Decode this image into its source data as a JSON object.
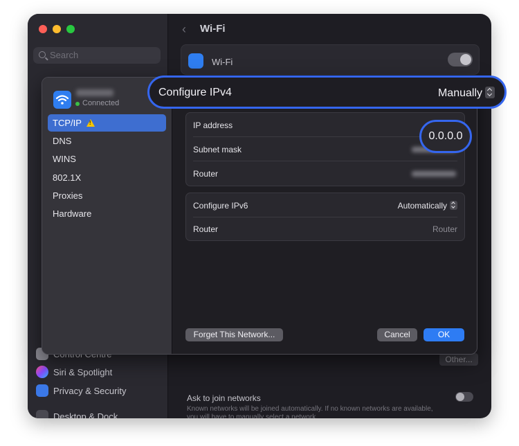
{
  "window": {
    "traffic_lights": [
      "#fe5f57",
      "#febc2e",
      "#28c840"
    ],
    "search_placeholder": "Search"
  },
  "sidebar": {
    "items": [
      {
        "label": "Control Centre",
        "icon": "control-centre-icon",
        "color": "#8e8d96"
      },
      {
        "label": "Siri & Spotlight",
        "icon": "siri-icon",
        "color": "#c24ad6"
      },
      {
        "label": "Privacy & Security",
        "icon": "hand-icon",
        "color": "#3b78e7"
      },
      {
        "label": "Desktop & Dock",
        "icon": "desktop-icon",
        "color": "#4a4951"
      }
    ]
  },
  "header": {
    "title": "Wi-Fi"
  },
  "wifi_card": {
    "label": "Wi-Fi"
  },
  "other_button": "Other...",
  "ask": {
    "title": "Ask to join networks",
    "description": "Known networks will be joined automatically. If no known networks are available, you will have to manually select a network."
  },
  "dialog": {
    "status": "Connected",
    "nav": [
      {
        "label": "TCP/IP",
        "selected": true,
        "warning": true
      },
      {
        "label": "DNS"
      },
      {
        "label": "WINS"
      },
      {
        "label": "802.1X"
      },
      {
        "label": "Proxies"
      },
      {
        "label": "Hardware"
      }
    ],
    "configure_ipv4": {
      "label": "Configure IPv4",
      "value": "Manually"
    },
    "ipv4_rows": {
      "ip_address": {
        "label": "IP address",
        "value": "0.0.0.0"
      },
      "subnet_mask": {
        "label": "Subnet mask"
      },
      "router": {
        "label": "Router"
      }
    },
    "ipv6": {
      "configure": {
        "label": "Configure IPv6",
        "value": "Automatically"
      },
      "router": {
        "label": "Router",
        "value": "Router"
      }
    },
    "buttons": {
      "forget": "Forget This Network...",
      "cancel": "Cancel",
      "ok": "OK"
    }
  },
  "accent_color": "#3566ee"
}
